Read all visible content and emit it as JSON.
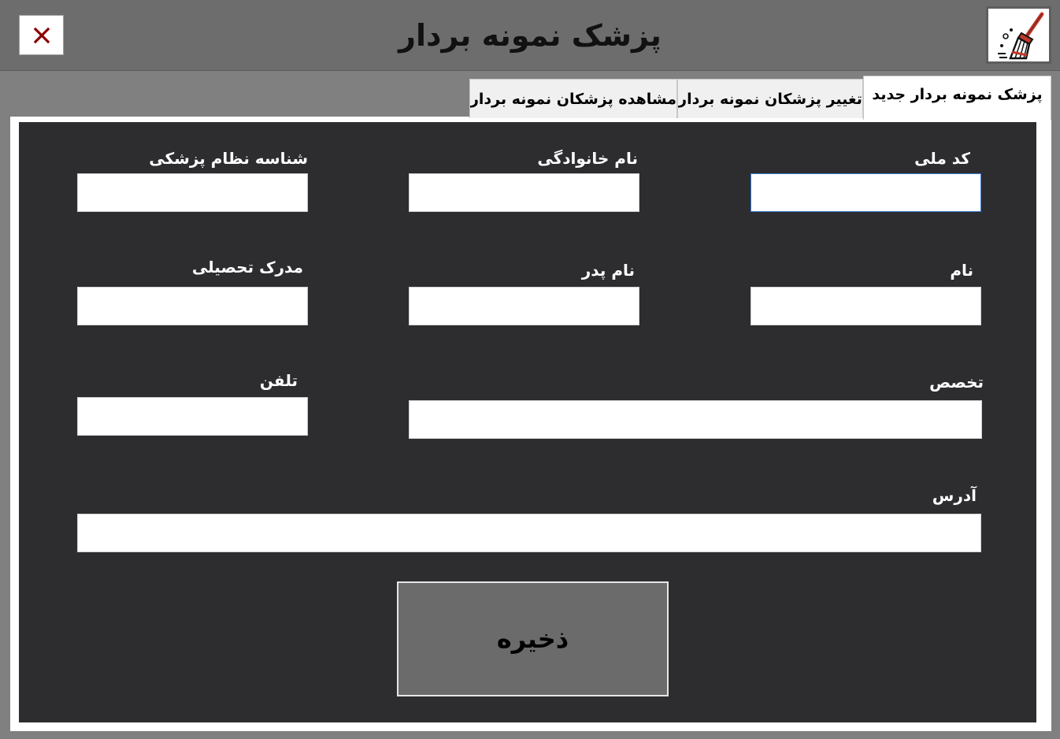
{
  "window": {
    "title": "پزشک نمونه بردار",
    "close_glyph": "✕",
    "close_icon_color": "#8b0000"
  },
  "tabs": [
    {
      "label": "پزشک نمونه بردار جدید",
      "active": true
    },
    {
      "label": "تغییر پزشکان نمونه بردار",
      "active": false
    },
    {
      "label": "مشاهده پزشکان نمونه بردار",
      "active": false
    }
  ],
  "form": {
    "national_code": {
      "label": "کد ملی",
      "value": ""
    },
    "last_name": {
      "label": "نام خانوادگی",
      "value": ""
    },
    "medical_id": {
      "label": "شناسه نظام پزشکی",
      "value": ""
    },
    "first_name": {
      "label": "نام",
      "value": ""
    },
    "father_name": {
      "label": "نام پدر",
      "value": ""
    },
    "degree": {
      "label": "مدرک تحصیلی",
      "value": ""
    },
    "specialty": {
      "label": "تخصص",
      "value": ""
    },
    "phone": {
      "label": "تلفن",
      "value": ""
    },
    "address": {
      "label": "آدرس",
      "value": ""
    },
    "save_label": "ذخیره"
  },
  "icons": {
    "close": "close-icon",
    "clear": "broom-icon"
  },
  "colors": {
    "titlebar": "#6d6d6d",
    "panel": "#2d2d30",
    "save_button": "#6b6b6b",
    "broom_red": "#c0392b"
  }
}
